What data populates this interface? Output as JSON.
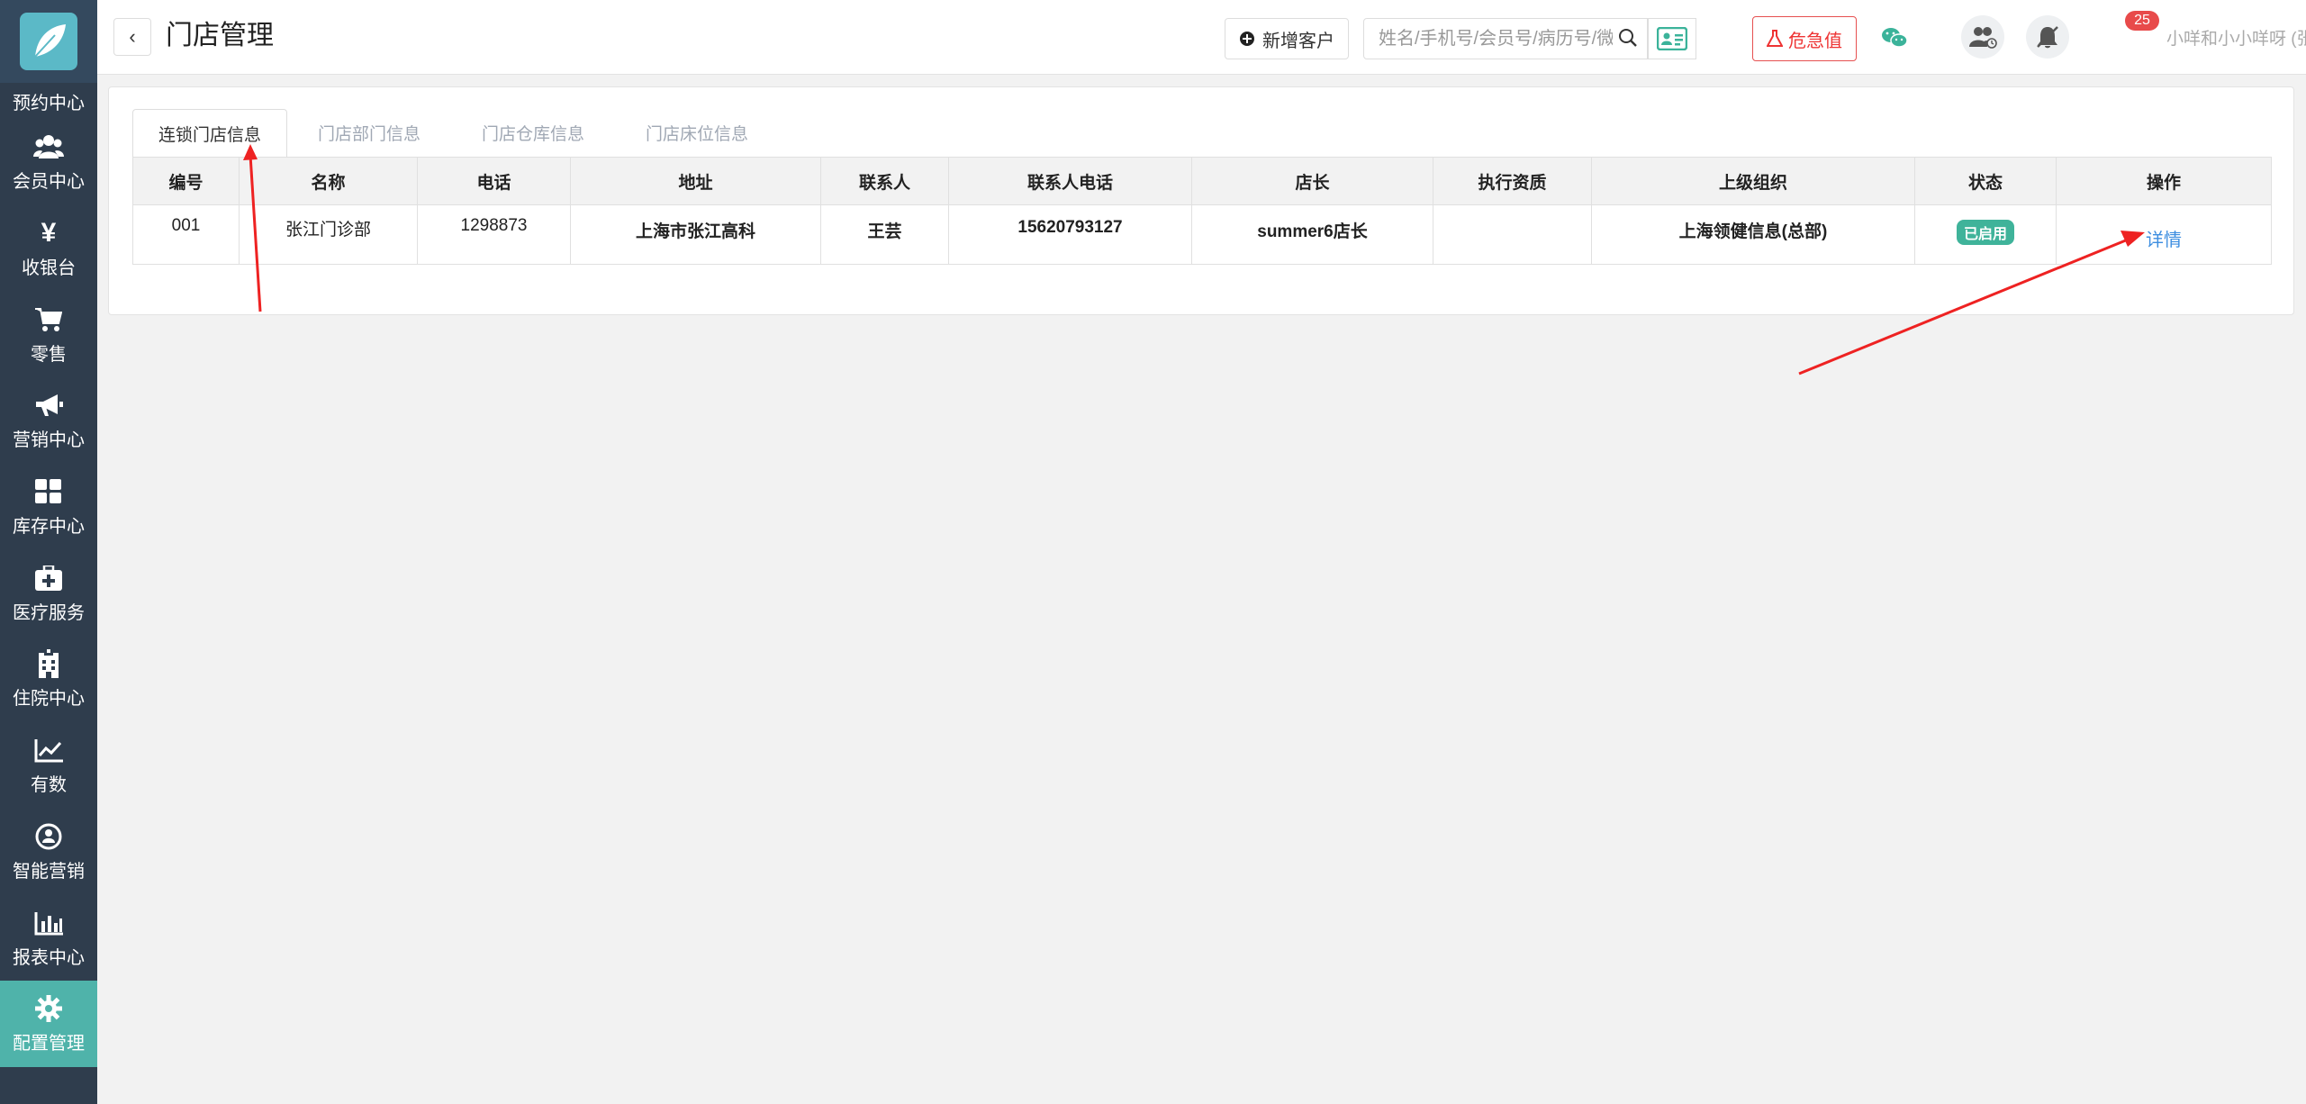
{
  "sidebar": {
    "cut_label": "预约中心",
    "items": [
      {
        "label": "会员中心",
        "icon": "members-icon"
      },
      {
        "label": "收银台",
        "icon": "yen-icon"
      },
      {
        "label": "零售",
        "icon": "cart-icon"
      },
      {
        "label": "营销中心",
        "icon": "megaphone-icon"
      },
      {
        "label": "库存中心",
        "icon": "grid-icon"
      },
      {
        "label": "医疗服务",
        "icon": "medkit-icon"
      },
      {
        "label": "住院中心",
        "icon": "hospital-icon"
      },
      {
        "label": "有数",
        "icon": "trend-icon"
      },
      {
        "label": "智能营销",
        "icon": "smart-marketing-icon"
      },
      {
        "label": "报表中心",
        "icon": "bar-chart-icon"
      },
      {
        "label": "配置管理",
        "icon": "gear-icon",
        "active": true
      }
    ]
  },
  "header": {
    "back": "‹",
    "title": "门店管理",
    "add_customer": "新增客户",
    "search_placeholder": "姓名/手机号/会员号/病历号/微信号",
    "critical_label": "危急值",
    "badge_count": "25",
    "user": "小咩和小小咩呀 (张江门诊部)"
  },
  "tabs": [
    {
      "label": "连锁门店信息",
      "active": true
    },
    {
      "label": "门店部门信息"
    },
    {
      "label": "门店仓库信息"
    },
    {
      "label": "门店床位信息"
    }
  ],
  "table": {
    "headers": [
      "编号",
      "名称",
      "电话",
      "地址",
      "联系人",
      "联系人电话",
      "店长",
      "执行资质",
      "上级组织",
      "状态",
      "操作"
    ],
    "rows": [
      {
        "id": "001",
        "name": "张江门诊部",
        "phone": "1298873",
        "address": "上海市张江高科",
        "contact": "王芸",
        "contact_phone": "15620793127",
        "manager": "summer6店长",
        "qualification": "",
        "parent_org": "上海领健信息(总部)",
        "status": "已启用",
        "action": "详情"
      }
    ]
  },
  "colors": {
    "sidebar_bg": "#2f3d4d",
    "active_nav": "#4fb3aa",
    "status_green": "#3fb39a",
    "link_blue": "#3d8ee0",
    "danger_red": "#e33",
    "arrow_red": "#ee2222"
  }
}
